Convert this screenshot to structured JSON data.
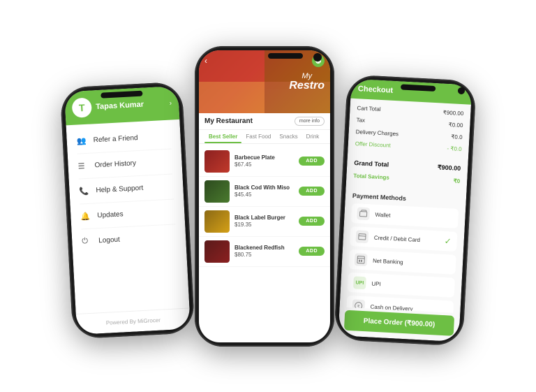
{
  "scene": {
    "bg": "#ffffff"
  },
  "phone1": {
    "user": {
      "name": "Tapas Kumar",
      "avatar": "T"
    },
    "menu_items": [
      {
        "icon": "👥",
        "label": "Refer a Friend"
      },
      {
        "icon": "☰",
        "label": "Order History"
      },
      {
        "icon": "📞",
        "label": "Help & Support"
      },
      {
        "icon": "🔔",
        "label": "Updates"
      },
      {
        "icon": "⏻",
        "label": "Logout"
      }
    ],
    "footer": "Powered By MiGrocer"
  },
  "phone2": {
    "restaurant_name": "My Restaurant",
    "title_my": "My",
    "title_restro": "Restro",
    "more_info": "more info",
    "tabs": [
      "Best Seller",
      "Fast Food",
      "Snacks",
      "Drink"
    ],
    "active_tab": 0,
    "items": [
      {
        "name": "Barbecue Plate",
        "price": "$67.45",
        "thumb_class": "food-thumb-1"
      },
      {
        "name": "Black Cod With Miso",
        "price": "$45.45",
        "thumb_class": "food-thumb-2"
      },
      {
        "name": "Black Label Burger",
        "price": "$19.35",
        "thumb_class": "food-thumb-3"
      },
      {
        "name": "Blackened Redfish",
        "price": "$80.75",
        "thumb_class": "food-thumb-4"
      }
    ],
    "add_label": "ADD"
  },
  "phone3": {
    "header": "Checkout",
    "rows": [
      {
        "label": "Cart Total",
        "value": "₹900.00",
        "type": "normal"
      },
      {
        "label": "Tax",
        "value": "₹0.00",
        "type": "normal"
      },
      {
        "label": "Delivery Charges",
        "value": "₹0.0",
        "type": "normal"
      },
      {
        "label": "Offer Discount",
        "value": "- ₹0.0",
        "type": "discount"
      },
      {
        "label": "Grand Total",
        "value": "₹900.00",
        "type": "grand"
      },
      {
        "label": "Total Savings",
        "value": "₹0",
        "type": "savings"
      }
    ],
    "payment_title": "Payment Methods",
    "payment_options": [
      {
        "icon": "💳",
        "label": "Wallet",
        "selected": false
      },
      {
        "icon": "💳",
        "label": "Credit / Debit Card",
        "selected": true
      },
      {
        "icon": "🏦",
        "label": "Net Banking",
        "selected": false
      },
      {
        "icon": "UPI",
        "label": "UPI",
        "selected": false,
        "icon_text": true
      },
      {
        "icon": "💵",
        "label": "Cash on Delivery",
        "selected": false
      }
    ],
    "place_order_btn": "Place Order (₹900.00)"
  }
}
